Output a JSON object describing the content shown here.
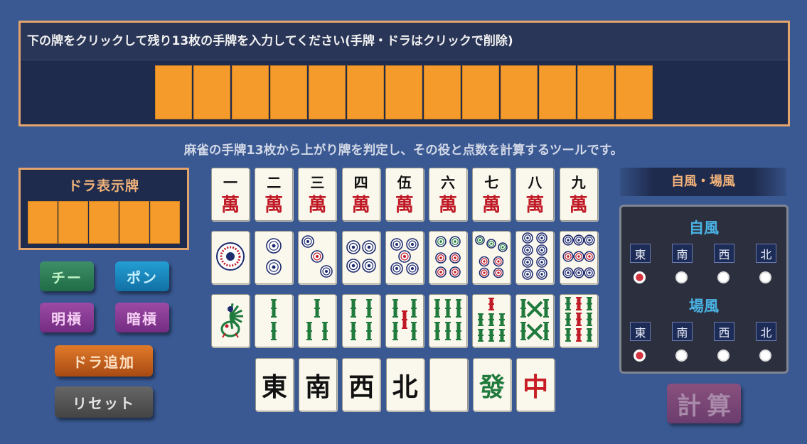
{
  "hand": {
    "instruction": "下の牌をクリックして残り13枚の手牌を入力してください(手牌・ドラはクリックで削除)",
    "slot_count": 13
  },
  "tagline": "麻雀の手牌13枚から上がり牌を判定し、その役と点数を計算するツールです。",
  "dora": {
    "title": "ドラ表示牌",
    "slot_count": 5
  },
  "buttons": {
    "chi": "チー",
    "pon": "ポン",
    "minkan": "明槓",
    "ankan": "暗槓",
    "add_dora": "ドラ追加",
    "reset": "リセット",
    "calculate": "計算"
  },
  "tiles": {
    "man": [
      {
        "top": "一",
        "bottom": "萬"
      },
      {
        "top": "二",
        "bottom": "萬"
      },
      {
        "top": "三",
        "bottom": "萬"
      },
      {
        "top": "四",
        "bottom": "萬"
      },
      {
        "top": "伍",
        "bottom": "萬"
      },
      {
        "top": "六",
        "bottom": "萬"
      },
      {
        "top": "七",
        "bottom": "萬"
      },
      {
        "top": "八",
        "bottom": "萬"
      },
      {
        "top": "九",
        "bottom": "萬"
      }
    ],
    "pin": [
      "1-pin-icon",
      "2-pin-icon",
      "3-pin-icon",
      "4-pin-icon",
      "5-pin-icon",
      "6-pin-icon",
      "7-pin-icon",
      "8-pin-icon",
      "9-pin-icon"
    ],
    "sou": [
      "1-sou-bird-icon",
      "2-sou-icon",
      "3-sou-icon",
      "4-sou-icon",
      "5-sou-icon",
      "6-sou-icon",
      "7-sou-icon",
      "8-sou-icon",
      "9-sou-icon"
    ],
    "honors": [
      {
        "char": "東",
        "color": "black"
      },
      {
        "char": "南",
        "color": "black"
      },
      {
        "char": "西",
        "color": "black"
      },
      {
        "char": "北",
        "color": "black"
      },
      {
        "char": "",
        "color": "white"
      },
      {
        "char": "發",
        "color": "green"
      },
      {
        "char": "中",
        "color": "red"
      }
    ]
  },
  "winds": {
    "banner": "自風・場風",
    "seat_label": "自風",
    "round_label": "場風",
    "options": [
      "東",
      "南",
      "西",
      "北"
    ],
    "seat_selected": "東",
    "round_selected": "東"
  },
  "colors": {
    "background": "#3a5993",
    "empty_slot": "#f49b2c",
    "panel_border": "#e2a46c",
    "man_red": "#c01a26",
    "wind_label": "#4ab3e4"
  }
}
